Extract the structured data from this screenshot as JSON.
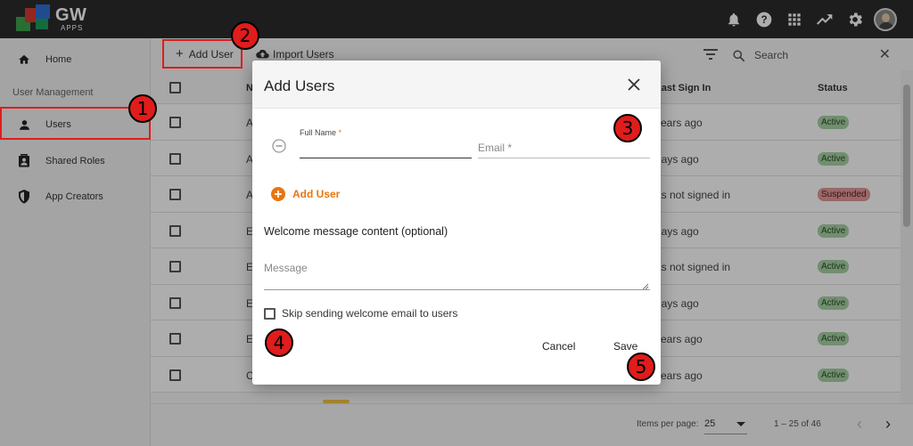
{
  "app": {
    "brand": "GW",
    "brand_sub": "APPS",
    "colors": {
      "topbar": "#2b2b2b",
      "accent": "#e8760c",
      "highlight": "#e01c1c",
      "active_badge": "#a7d3a4",
      "suspended_badge": "#e49a9a"
    }
  },
  "topbar": {
    "icons": [
      "bell-icon",
      "help-icon",
      "apps-grid-icon",
      "trending-icon",
      "gear-icon",
      "avatar"
    ]
  },
  "sidebar": {
    "home": "Home",
    "section": "User Management",
    "items": [
      {
        "label": "Users",
        "icon": "person-icon",
        "selected": true
      },
      {
        "label": "Shared Roles",
        "icon": "contact-card-icon"
      },
      {
        "label": "App Creators",
        "icon": "shield-icon"
      }
    ]
  },
  "toolbar": {
    "add_user": "Add User",
    "import_users": "Import Users",
    "search_placeholder": "Search"
  },
  "table": {
    "headers": {
      "name": "N",
      "last_sign_in": "Last Sign In",
      "status": "Status"
    },
    "rows": [
      {
        "name": "A",
        "last_sign_in": "years ago",
        "status": "Active"
      },
      {
        "name": "A",
        "last_sign_in": "days ago",
        "status": "Active"
      },
      {
        "name": "A",
        "last_sign_in": "as not signed in",
        "status": "Suspended"
      },
      {
        "name": "E",
        "last_sign_in": "days ago",
        "status": "Active"
      },
      {
        "name": "E",
        "last_sign_in": "as not signed in",
        "status": "Active"
      },
      {
        "name": "E",
        "last_sign_in": "days ago",
        "status": "Active"
      },
      {
        "name": "E",
        "last_sign_in": "years ago",
        "status": "Active"
      },
      {
        "name": "C",
        "last_sign_in": "years ago",
        "status": "Active"
      }
    ]
  },
  "footer": {
    "items_per_page_label": "Items per page:",
    "items_per_page": "25",
    "range": "1 – 25 of 46"
  },
  "dialog": {
    "title": "Add Users",
    "full_name_label": "Full Name",
    "required_mark": "*",
    "email_placeholder": "Email *",
    "add_user": "Add User",
    "welcome_label": "Welcome message content (optional)",
    "message_placeholder": "Message",
    "skip_label": "Skip sending welcome email to users",
    "cancel": "Cancel",
    "save": "Save"
  },
  "callouts": [
    "1",
    "2",
    "3",
    "4",
    "5"
  ]
}
